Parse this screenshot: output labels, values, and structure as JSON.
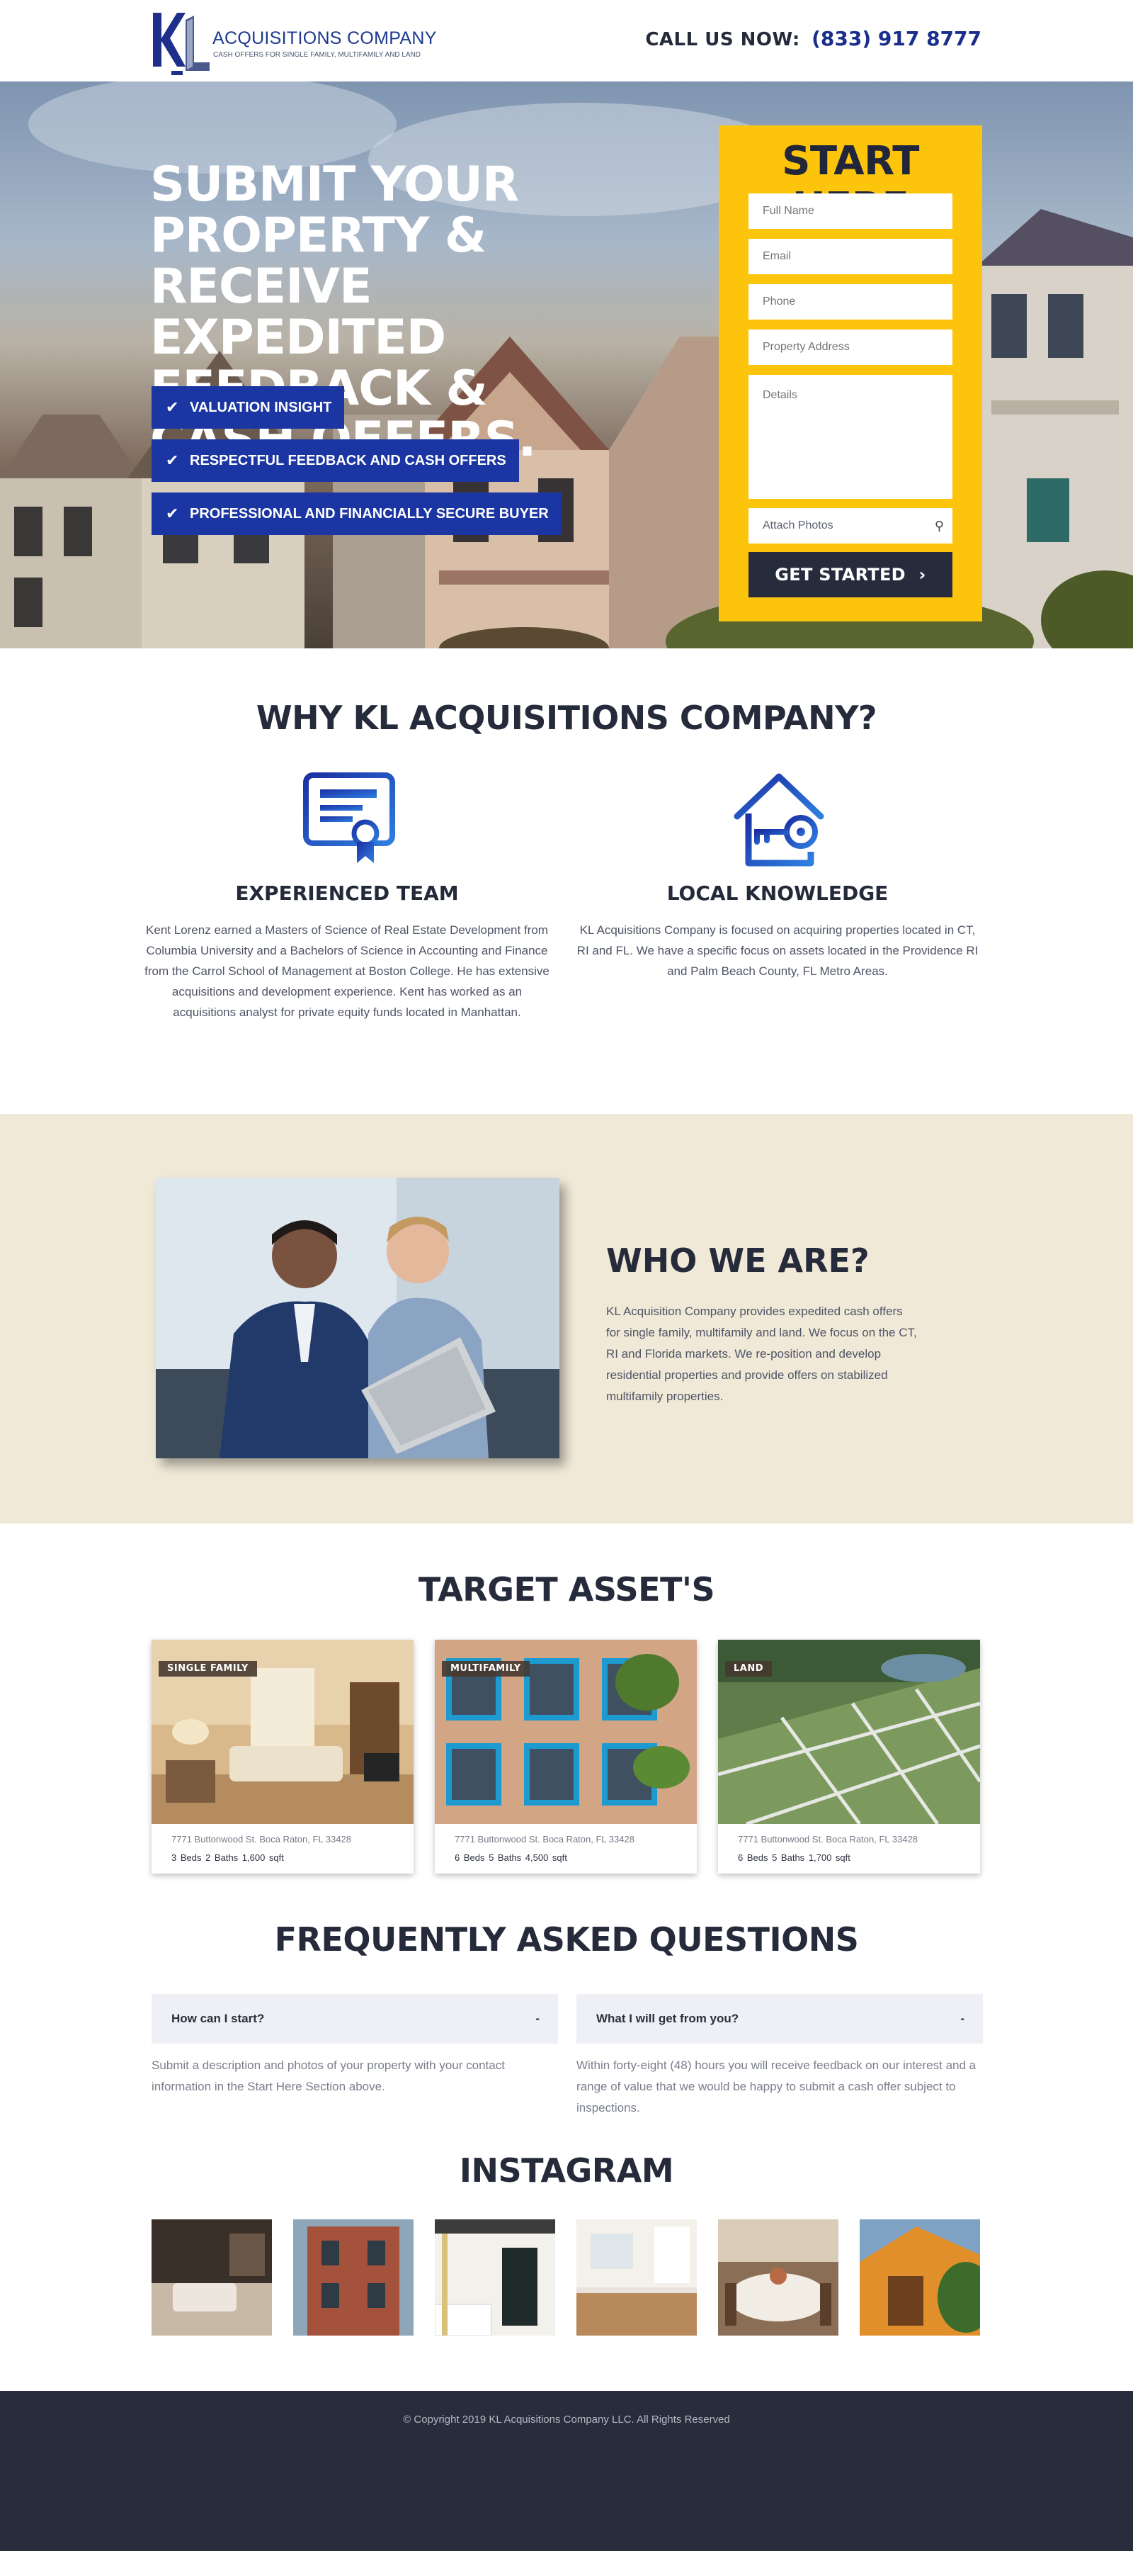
{
  "header": {
    "logo_name": "ACQUISITIONS COMPANY",
    "logo_tagline": "CASH OFFERS FOR SINGLE FAMILY, MULTIFAMILY AND LAND",
    "call_label": "CALL US NOW:",
    "phone": "(833) 917 8777"
  },
  "hero": {
    "title": "SUBMIT YOUR PROPERTY & RECEIVE EXPEDITED FEEDBACK & CASH OFFERS.",
    "features": [
      "VALUATION INSIGHT",
      "RESPECTFUL FEEDBACK AND CASH OFFERS",
      "PROFESSIONAL AND FINANCIALLY SECURE BUYER"
    ],
    "check_icon": "check-icon"
  },
  "form": {
    "title": "START HERE",
    "full_name_placeholder": "Full Name",
    "email_placeholder": "Email",
    "phone_placeholder": "Phone",
    "address_placeholder": "Property Address",
    "details_placeholder": "Details",
    "attach_label": "Attach Photos",
    "attach_icon": "paperclip-icon",
    "submit_label": "GET STARTED",
    "submit_icon": "chevron-right-icon"
  },
  "why": {
    "title": "WHY KL ACQUISITIONS COMPANY?",
    "cols": [
      {
        "icon": "certificate-icon",
        "title": "EXPERIENCED TEAM",
        "text": "Kent Lorenz earned a Masters of  Science of Real Estate Development from Columbia University and a Bachelors of Science in Accounting and Finance from the Carrol School of Management at Boston College. He has extensive acquisitions and development experience. Kent has worked as an acquisitions analyst for private equity funds located in Manhattan."
      },
      {
        "icon": "house-key-icon",
        "title": "LOCAL KNOWLEDGE",
        "text": "KL Acquisitions Company is focused on acquiring properties located in CT, RI and FL. We have a specific focus on assets located in the Providence RI and Palm Beach County, FL Metro Areas."
      }
    ]
  },
  "who": {
    "title": "WHO WE ARE?",
    "text": "KL Acquisition Company provides expedited cash offers for single family, multifamily and land. We focus on the CT, RI and Florida markets. We re-position and develop residential properties and provide offers on stabilized multifamily properties."
  },
  "assets": {
    "title": "TARGET ASSET'S",
    "cards": [
      {
        "badge": "SINGLE FAMILY",
        "address": "7771 Buttonwood St. Boca Raton, FL 33428",
        "specs": "3 Beds   2 Baths   1,600 sqft"
      },
      {
        "badge": "MULTIFAMILY",
        "address": "7771 Buttonwood St. Boca Raton, FL 33428",
        "specs": "6 Beds   5 Baths   4,500 sqft"
      },
      {
        "badge": "LAND",
        "address": "7771 Buttonwood St. Boca Raton, FL 33428",
        "specs": "6 Beds   5 Baths   1,700 sqft"
      }
    ]
  },
  "faq": {
    "title": "FREQUENTLY ASKED QUESTIONS",
    "items": [
      {
        "q": "How can I start?",
        "toggle": "-",
        "a": "Submit a description and photos of your property with your contact information in the Start Here Section above."
      },
      {
        "q": "What I will get from you?",
        "toggle": "-",
        "a": "Within forty-eight (48) hours you will receive feedback on our interest and a range of value that we would be happy to submit a cash offer subject to inspections."
      }
    ]
  },
  "instagram": {
    "title": "INSTAGRAM"
  },
  "footer": {
    "copyright": "© Copyright 2019 KL Acquisitions Company LLC. All Rights Reserved"
  },
  "colors": {
    "brand_blue": "#1b36a3",
    "accent_yellow": "#fcc40b",
    "dark": "#272c3d",
    "beige": "#f0e9d7"
  }
}
